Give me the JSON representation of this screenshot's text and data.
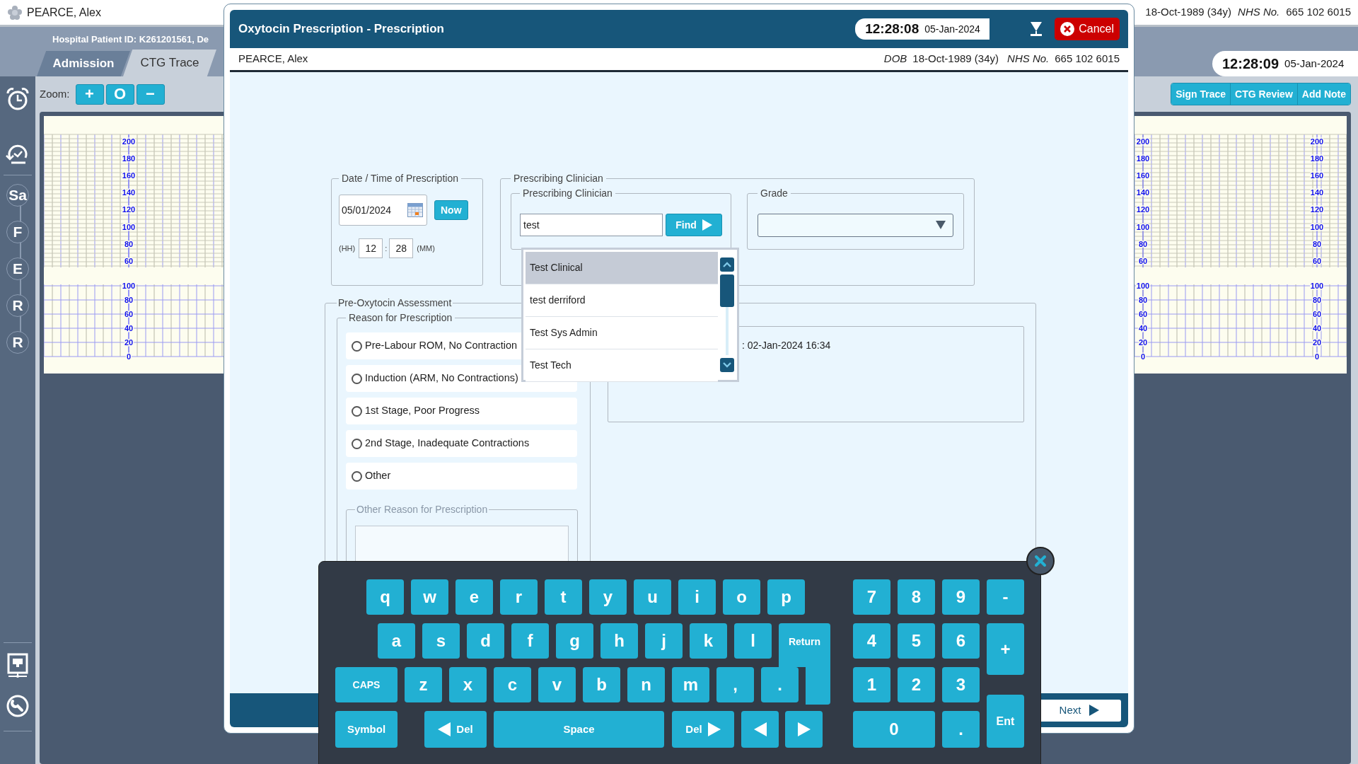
{
  "app_header": {
    "patient_name": "PEARCE, Alex",
    "dob": "18-Oct-1989 (34y)",
    "nhs_label": "NHS No.",
    "nhs_number": "665 102 6015",
    "patient_id": "Hospital Patient ID: K261201561, De",
    "clock_time": "12:28:09",
    "clock_date": "05-Jan-2024"
  },
  "tabs": [
    {
      "label": "Admission",
      "selected": false
    },
    {
      "label": "CTG Trace",
      "selected": true
    }
  ],
  "sidebar": [
    {
      "kind": "alarm"
    },
    {
      "kind": "history"
    },
    {
      "kind": "letter",
      "label": "Sa"
    },
    {
      "kind": "letter",
      "label": "F"
    },
    {
      "kind": "letter",
      "label": "E"
    },
    {
      "kind": "letter",
      "label": "R"
    },
    {
      "kind": "letter",
      "label": "R"
    },
    {
      "kind": "network"
    },
    {
      "kind": "search-tool"
    }
  ],
  "zoom": {
    "label": "Zoom:",
    "buttons": [
      "+",
      "O",
      "−"
    ]
  },
  "trace_actions": [
    "Sign Trace",
    "CTG Review",
    "Add Note"
  ],
  "ctg_scales": [
    {
      "upper": [
        "200",
        "180",
        "160",
        "140",
        "120",
        "100",
        "80",
        "60"
      ],
      "lower": [
        "100",
        "80",
        "60",
        "40",
        "20",
        "0"
      ]
    },
    {
      "upper": [
        "200",
        "180",
        "160",
        "140",
        "120",
        "100",
        "80",
        "60"
      ],
      "lower": [
        "100",
        "80",
        "60",
        "40",
        "20",
        "0"
      ]
    },
    {
      "upper": [
        "200",
        "180",
        "160",
        "140",
        "120",
        "100",
        "80",
        "60"
      ],
      "lower": [
        "100",
        "80",
        "60",
        "40",
        "20",
        "0"
      ]
    }
  ],
  "dialog": {
    "title": "Oxytocin Prescription - Prescription",
    "clock_time": "12:28:08",
    "clock_date": "05-Jan-2024",
    "cancel": "Cancel",
    "patient_name": "PEARCE, Alex",
    "dob_label": "DOB",
    "dob": "18-Oct-1989 (34y)",
    "nhs_label": "NHS No.",
    "nhs_number": "665 102 6015",
    "datetime": {
      "legend": "Date / Time of Prescription",
      "date": "05/01/2024",
      "now": "Now",
      "hh_label": "(HH)",
      "hour": "12",
      "separator": ":",
      "minute": "28",
      "mm_label": "(MM)"
    },
    "clinician": {
      "legend": "Prescribing Clinician",
      "search_legend": "Prescribing Clinician",
      "search_value": "test",
      "find": "Find",
      "grade_legend": "Grade"
    },
    "assessment": {
      "legend": "Pre-Oxytocin Assessment",
      "reason_legend": "Reason for Prescription",
      "reasons": [
        {
          "label": "Pre-Labour ROM, No Contraction",
          "selected": false
        },
        {
          "label": "Induction (ARM, No Contractions)",
          "selected": false
        },
        {
          "label": "1st Stage, Poor Progress",
          "selected": false
        },
        {
          "label": "2nd Stage, Inadequate Contractions",
          "selected": false
        },
        {
          "label": "Other",
          "selected": false
        }
      ],
      "other_legend": "Other Reason for Prescription",
      "other_disabled": true,
      "info_text": ": 02-Jan-2024 16:34"
    },
    "next": "Next"
  },
  "clinician_dropdown": [
    {
      "label": "Test Clinical",
      "selected": true
    },
    {
      "label": "test derriford",
      "selected": false
    },
    {
      "label": "Test Sys Admin",
      "selected": false
    },
    {
      "label": "Test Tech",
      "selected": false
    }
  ],
  "keyboard": {
    "letter_rows": [
      [
        "q",
        "w",
        "e",
        "r",
        "t",
        "y",
        "u",
        "i",
        "o",
        "p"
      ],
      [
        "a",
        "s",
        "d",
        "f",
        "g",
        "h",
        "j",
        "k",
        "l"
      ],
      [
        "z",
        "x",
        "c",
        "v",
        "b",
        "n",
        "m",
        ",",
        "."
      ]
    ],
    "return": "Return",
    "caps": "CAPS",
    "bottom_row": [
      {
        "kind": "wide",
        "label": "Symbol"
      },
      {
        "kind": "back-del",
        "label": "Del"
      },
      {
        "kind": "space",
        "label": "Space"
      },
      {
        "kind": "fwd-del",
        "label": "Del"
      },
      {
        "kind": "left"
      },
      {
        "kind": "right"
      }
    ],
    "numpad": [
      "7",
      "8",
      "9",
      "-",
      "4",
      "5",
      "6",
      "+",
      "1",
      "2",
      "3",
      "0",
      ".",
      "Ent"
    ]
  }
}
